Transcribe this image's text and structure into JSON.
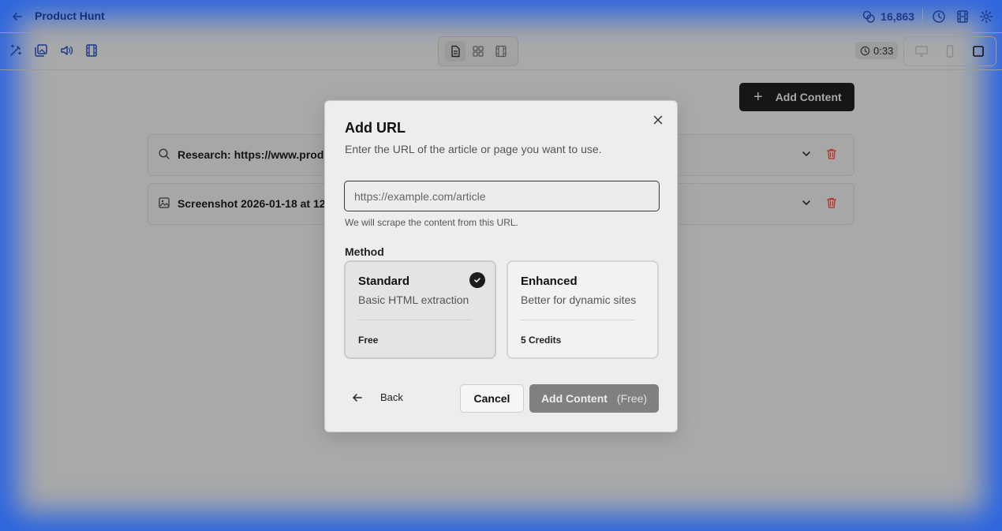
{
  "header": {
    "title": "Product Hunt",
    "credits": "16,863"
  },
  "toolbar": {
    "timer": "0:33"
  },
  "background": {
    "add_content_label": "Add Content",
    "rows": [
      {
        "text": "Research: https://www.prod"
      },
      {
        "text": "Screenshot 2026-01-18 at 12"
      }
    ]
  },
  "modal": {
    "title": "Add URL",
    "subtitle": "Enter the URL of the article or page you want to use.",
    "url_placeholder": "https://example.com/article",
    "url_value": "",
    "hint": "We will scrape the content from this URL.",
    "method_label": "Method",
    "methods": [
      {
        "title": "Standard",
        "desc": "Basic HTML extraction",
        "price": "Free",
        "selected": true
      },
      {
        "title": "Enhanced",
        "desc": "Better for dynamic sites",
        "price": "5 Credits",
        "selected": false
      }
    ],
    "back_label": "Back",
    "cancel_label": "Cancel",
    "submit_label": "Add Content",
    "submit_cost": "(Free)"
  },
  "colors": {
    "brand": "#2563d9",
    "header_text": "#15307a",
    "danger": "#c0392b",
    "submit_bg": "#808080"
  }
}
